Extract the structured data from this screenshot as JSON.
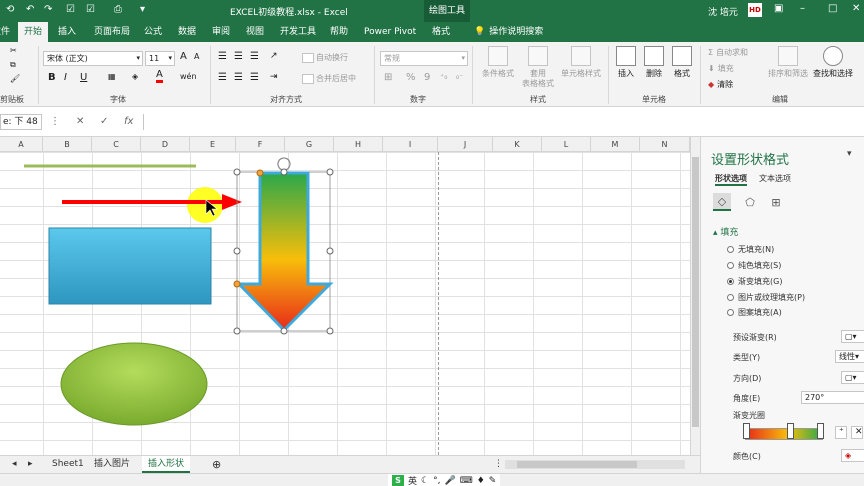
{
  "titlebar": {
    "filename": "EXCEL初级教程.xlsx",
    "separator": "-",
    "app": "Excel",
    "contextual_group": "绘图工具",
    "user": "沈 培元",
    "avatar": "HD",
    "icons": [
      "save-icon",
      "undo-icon",
      "redo-icon",
      "checkbox-icon",
      "print-preview-icon",
      "ribbon-display-icon",
      "minimize-icon",
      "restore-icon",
      "close-icon"
    ]
  },
  "tabs": [
    "文件",
    "开始",
    "插入",
    "页面布局",
    "公式",
    "数据",
    "审阅",
    "视图",
    "开发工具",
    "帮助",
    "Power Pivot",
    "格式"
  ],
  "active_tab": "开始",
  "tell_me": "操作说明搜索",
  "ribbon": {
    "clipboard_label": "剪贴板",
    "font": {
      "label": "字体",
      "name": "宋体 (正文)",
      "size": "11",
      "bold": "B",
      "italic": "I",
      "underline": "U",
      "grow": "A",
      "shrink": "A",
      "font_color": "A",
      "phonetic": "wén"
    },
    "alignment": {
      "label": "对齐方式",
      "wrap": "自动换行",
      "merge": "合并后居中"
    },
    "number": {
      "label": "数字",
      "format": "常规",
      "percent": "%",
      "comma": "9"
    },
    "styles": {
      "label": "样式",
      "conditional": "条件格式",
      "table1": "套用",
      "table2": "表格格式",
      "cell": "单元格样式"
    },
    "cells": {
      "label": "单元格",
      "insert": "插入",
      "delete": "删除",
      "format": "格式"
    },
    "editing": {
      "label": "编辑",
      "autosum": "自动求和",
      "fill": "填充",
      "clear": "清除",
      "sort": "排序和筛选",
      "find": "查找和选择"
    }
  },
  "formula_bar": {
    "name_box": "e: 下 48",
    "cancel": "✕",
    "enter": "✓",
    "fx": "fx",
    "value": ""
  },
  "grid": {
    "columns": [
      "A",
      "B",
      "C",
      "D",
      "E",
      "F",
      "G",
      "H",
      "I",
      "J",
      "K",
      "L",
      "M",
      "N"
    ]
  },
  "shapes": {
    "fill_colors": {
      "line": "#9bbb59",
      "arrow_red": "#ff0000",
      "highlight": "#ffff00",
      "rect": "#3fb0d8",
      "oval": "#8cc63f",
      "down_top": "#2aa84a",
      "down_mid": "#f7be0a",
      "down_bottom": "#e82a1a",
      "down_outline": "#3ea9dc"
    }
  },
  "sheets": [
    "Sheet1",
    "插入图片",
    "插入形状"
  ],
  "active_sheet": "插入形状",
  "add_sheet": "⊕",
  "ime": {
    "logo": "S",
    "mode": "英",
    "icons": [
      "moon-icon",
      "punctuation-icon",
      "mic-icon",
      "keyboard-icon",
      "skin-icon",
      "wrench-icon"
    ]
  },
  "pane": {
    "title": "设置形状格式",
    "close": "▾",
    "tabs": [
      "形状选项",
      "文本选项"
    ],
    "section": "填充",
    "fill_options": [
      {
        "label": "无填充(N)",
        "selected": false
      },
      {
        "label": "纯色填充(S)",
        "selected": false
      },
      {
        "label": "渐变填充(G)",
        "selected": true
      },
      {
        "label": "图片或纹理填充(P)",
        "selected": false
      },
      {
        "label": "图案填充(A)",
        "selected": false
      }
    ],
    "preset_label": "预设渐变(R)",
    "type_label": "类型(Y)",
    "type_value": "线性",
    "direction_label": "方向(D)",
    "angle_label": "角度(E)",
    "angle_value": "270°",
    "stops_label": "渐变光圈",
    "color_label": "颜色(C)",
    "gradient_colors": [
      "#e82a1a",
      "#f7be0a",
      "#2aa84a"
    ]
  }
}
